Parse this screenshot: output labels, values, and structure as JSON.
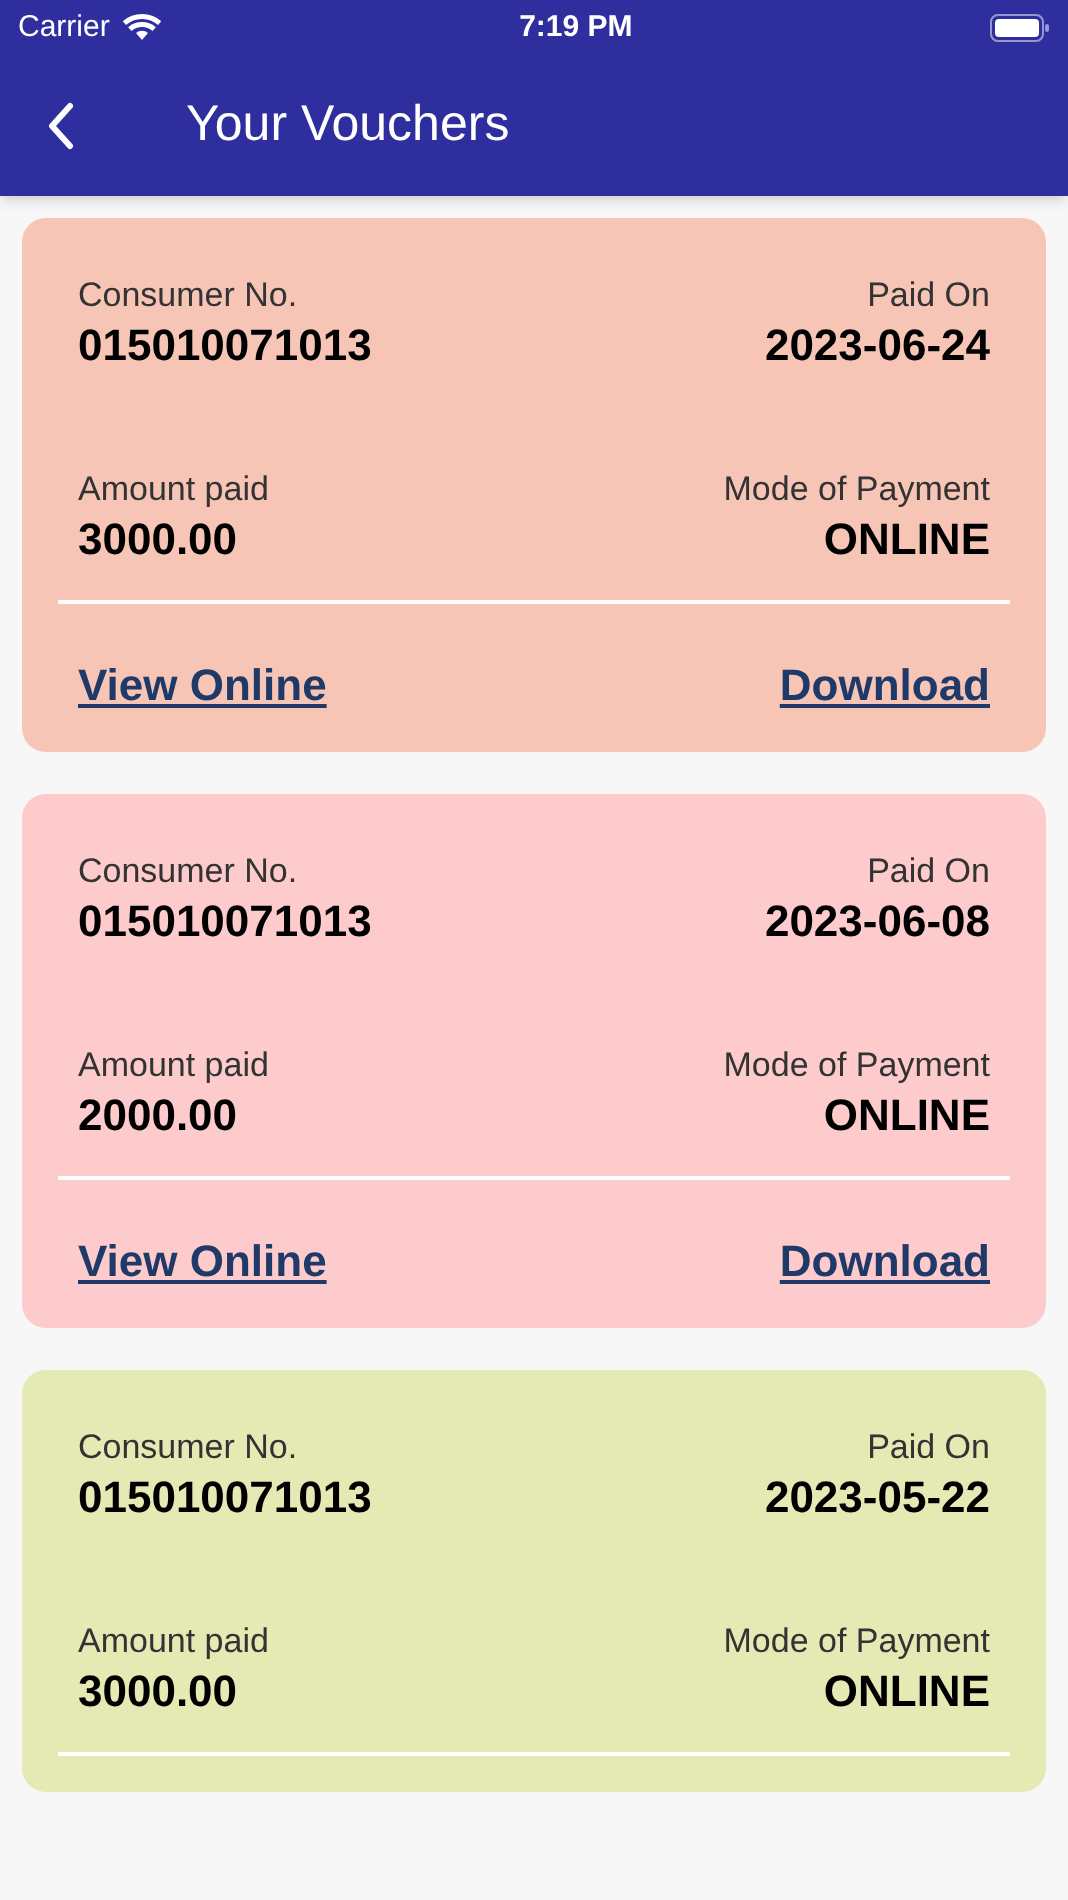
{
  "status_bar": {
    "carrier": "Carrier",
    "time": "7:19 PM"
  },
  "header": {
    "title": "Your Vouchers"
  },
  "vouchers": [
    {
      "color": "#f7c5b5",
      "consumer_label": "Consumer No.",
      "consumer_no": "015010071013",
      "paid_on_label": "Paid On",
      "paid_on": "2023-06-24",
      "amount_label": "Amount paid",
      "amount": "3000.00",
      "mode_label": "Mode of Payment",
      "mode": "ONLINE",
      "links": [
        "View Online",
        "Download"
      ]
    },
    {
      "color": "#fdcbcb",
      "consumer_label": "Consumer No.",
      "consumer_no": "015010071013",
      "paid_on_label": "Paid On",
      "paid_on": "2023-06-08",
      "amount_label": "Amount paid",
      "amount": "2000.00",
      "mode_label": "Mode of Payment",
      "mode": "ONLINE",
      "links": [
        "View Online",
        "Download"
      ]
    },
    {
      "color": "#e5e9b4",
      "consumer_label": "Consumer No.",
      "consumer_no": "015010071013",
      "paid_on_label": "Paid On",
      "paid_on": "2023-05-22",
      "amount_label": "Amount paid",
      "amount": "3000.00",
      "mode_label": "Mode of Payment",
      "mode": "ONLINE"
    }
  ]
}
